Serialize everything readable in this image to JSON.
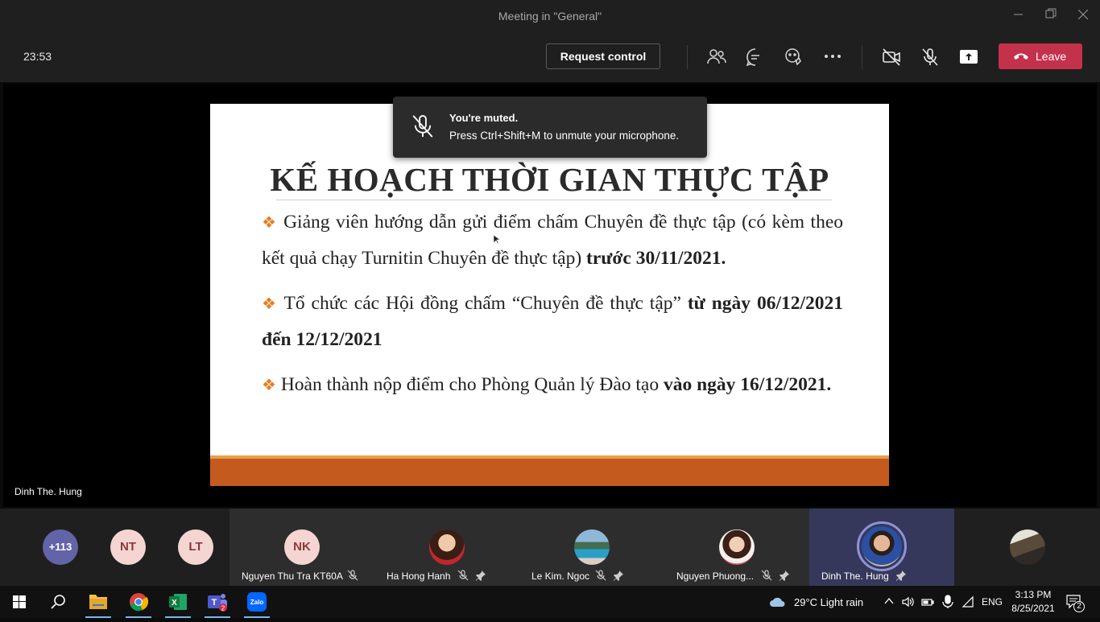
{
  "window": {
    "title": "Meeting in \"General\""
  },
  "toolbar": {
    "timer": "23:53",
    "request_control": "Request control",
    "leave": "Leave"
  },
  "toast": {
    "title": "You're muted.",
    "message": "Press Ctrl+Shift+M to unmute your microphone."
  },
  "slide": {
    "heading": "KẾ HOẠCH THỜI GIAN THỰC TẬP",
    "bullets": [
      {
        "text": "Giảng viên hướng dẫn gửi điểm chấm Chuyên đề thực tập (có kèm theo kết quả chạy Turnitin Chuyên đề thực tập) ",
        "bold": "trước 30/11/2021."
      },
      {
        "text": "Tổ chức các Hội đồng chấm “Chuyên đề thực tập” ",
        "bold": "từ ngày 06/12/2021 đến 12/12/2021"
      },
      {
        "text": "Hoàn thành nộp điểm cho Phòng Quản lý Đào tạo ",
        "bold": "vào ngày 16/12/2021."
      }
    ]
  },
  "stage": {
    "speaker_name": "Dinh The. Hung"
  },
  "gallery": {
    "overflow_count": "+113",
    "initials": [
      "NT",
      "LT"
    ],
    "tiles": [
      {
        "initials": "NK",
        "name": "Nguyen Thu Tra KT60A"
      },
      {
        "name": "Ha Hong Hanh"
      },
      {
        "name": "Le Kim. Ngoc"
      },
      {
        "name": "Nguyen Phuong..."
      },
      {
        "name": "Dinh The. Hung"
      }
    ]
  },
  "taskbar": {
    "weather": "29°C  Light rain",
    "language": "ENG",
    "time": "3:13 PM",
    "date": "8/25/2021",
    "notification_count": "2"
  },
  "colors": {
    "leave": "#c4314b",
    "accent": "#6264a7",
    "slide_bar": "#c55a1e",
    "bullet": "#e67e22"
  }
}
